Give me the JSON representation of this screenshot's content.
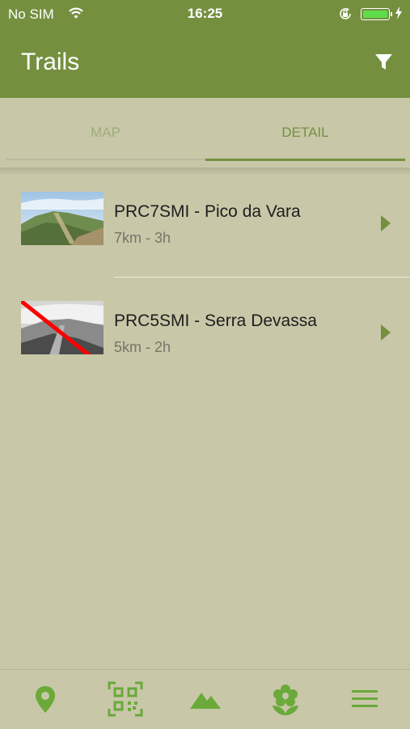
{
  "status_bar": {
    "carrier": "No SIM",
    "time": "16:25",
    "battery_level": 1.0,
    "icons": [
      "wifi-icon",
      "orientation-lock-icon",
      "battery-icon",
      "charging-bolt-icon"
    ]
  },
  "header": {
    "title": "Trails",
    "filter_icon": "filter-icon"
  },
  "tabs": [
    {
      "label": "MAP",
      "selected": false
    },
    {
      "label": "DETAIL",
      "selected": true
    }
  ],
  "trails": [
    {
      "name": "PRC7SMI - Pico da Vara",
      "meta": "7km - 3h",
      "thumbnail": "mountain-ridge-photo",
      "crossed_out": false
    },
    {
      "name": "PRC5SMI - Serra Devassa",
      "meta": "5km - 2h",
      "thumbnail": "grayscale-trail-photo",
      "crossed_out": true
    }
  ],
  "bottom_nav": [
    {
      "icon": "map-pin-icon"
    },
    {
      "icon": "qr-code-icon"
    },
    {
      "icon": "mountain-icon"
    },
    {
      "icon": "flower-icon"
    },
    {
      "icon": "menu-icon"
    }
  ],
  "colors": {
    "primary": "#74903f",
    "background": "#c8c7a8",
    "accent_icon": "#6aa93a",
    "disabled_line": "#ff0000"
  }
}
